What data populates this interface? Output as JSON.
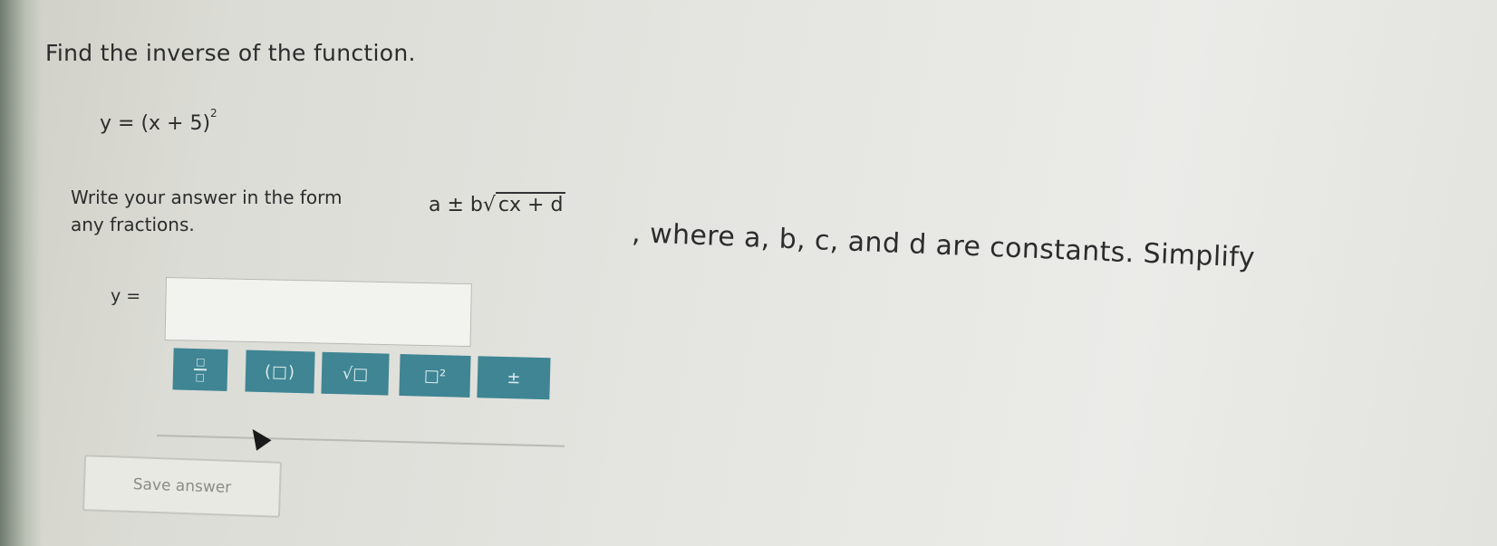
{
  "question": {
    "title": "Find the inverse of the function.",
    "equation": "y = (x + 5)",
    "exponent": "2",
    "instruction_start": "Write your answer in the form",
    "instruction_line2": "any fractions.",
    "form_expr_prefix": "a ± b",
    "form_expr_radicand": "cx + d",
    "instruction_end": ", where a, b, c, and d are constants. Simplify"
  },
  "answer": {
    "label": "y =",
    "value": ""
  },
  "toolbar": {
    "fraction_numer": "□",
    "fraction_denom": "□",
    "paren_label": "(□)",
    "sqrt_label": "√□",
    "power_label": "□²",
    "plusminus_label": "±"
  },
  "save": {
    "label": "Save answer"
  },
  "colors": {
    "tool_button_bg": "#3f8594"
  }
}
